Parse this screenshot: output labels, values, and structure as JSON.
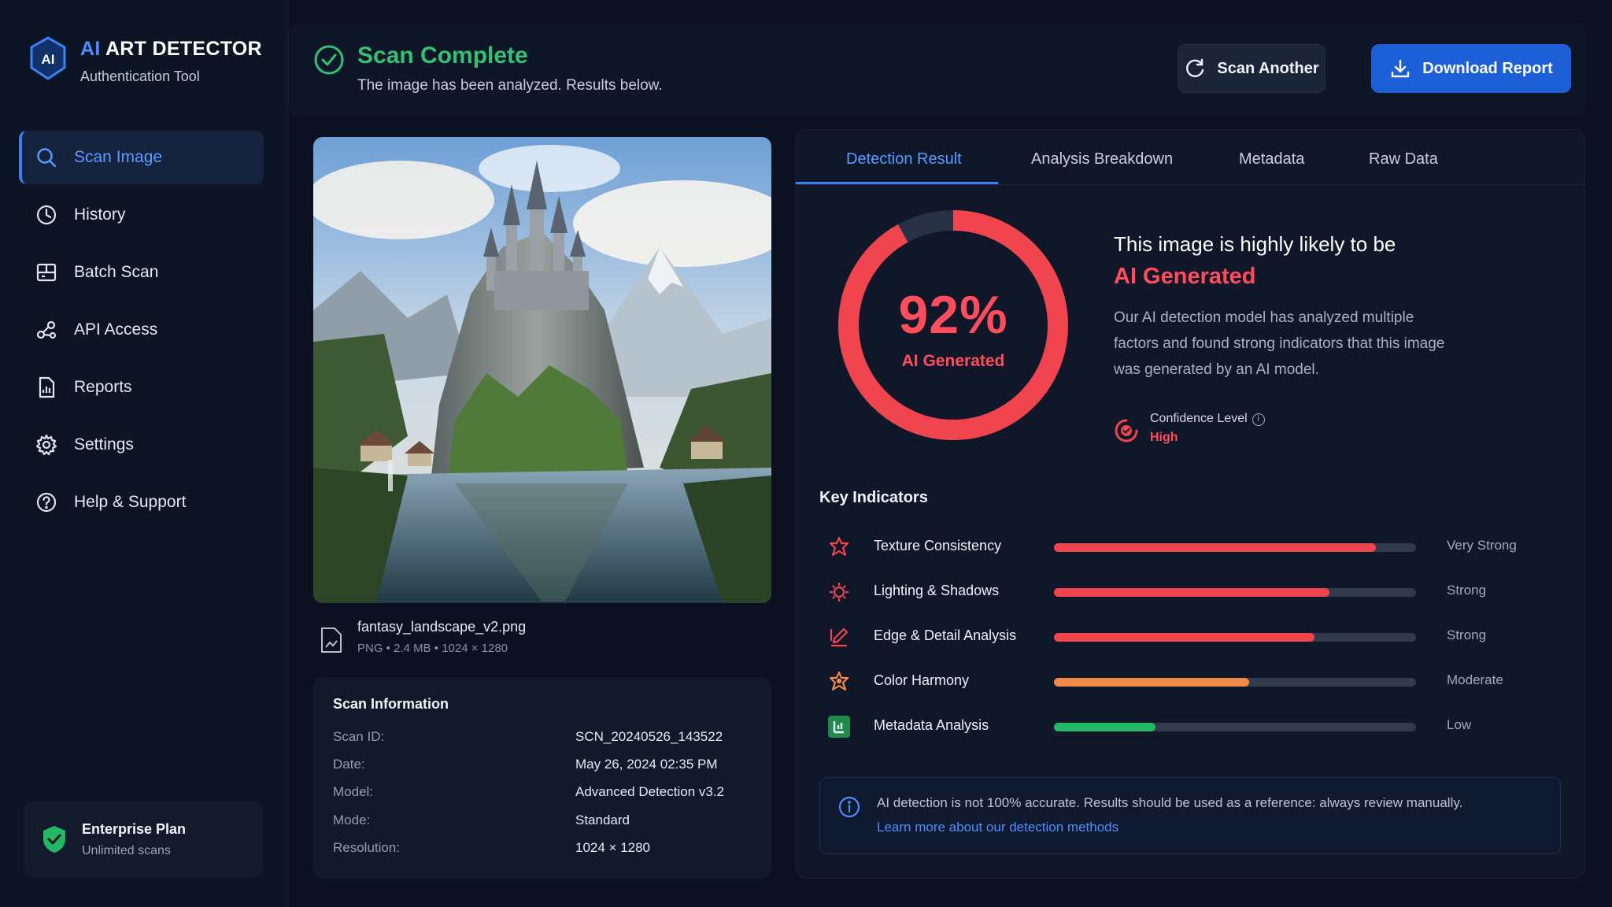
{
  "brand": {
    "title_ai": "AI",
    "title_rest": "ART DETECTOR",
    "subtitle": "Authentication Tool",
    "logo_text": "AI"
  },
  "sidebar": {
    "items": [
      {
        "label": "Scan Image",
        "icon": "search-icon",
        "active": true
      },
      {
        "label": "History",
        "icon": "clock-icon"
      },
      {
        "label": "Batch Scan",
        "icon": "batch-icon"
      },
      {
        "label": "API Access",
        "icon": "api-icon"
      },
      {
        "label": "Reports",
        "icon": "report-icon"
      },
      {
        "label": "Settings",
        "icon": "gear-icon"
      },
      {
        "label": "Help & Support",
        "icon": "help-icon"
      }
    ],
    "plan": {
      "title": "Enterprise Plan",
      "subtitle": "Unlimited scans"
    }
  },
  "header": {
    "title": "Scan Complete",
    "subtitle": "The image has been analyzed. Results below.",
    "scan_another": "Scan Another",
    "download_report": "Download Report"
  },
  "file": {
    "name": "fantasy_landscape_v2.png",
    "meta": "PNG • 2.4 MB • 1024 × 1280"
  },
  "scan_info": {
    "title": "Scan Information",
    "rows": [
      {
        "k": "Scan ID:",
        "v": "SCN_20240526_143522"
      },
      {
        "k": "Date:",
        "v": "May 26, 2024 02:35 PM"
      },
      {
        "k": "Model:",
        "v": "Advanced Detection v3.2"
      },
      {
        "k": "Mode:",
        "v": "Standard"
      },
      {
        "k": "Resolution:",
        "v": "1024 × 1280"
      }
    ]
  },
  "tabs": [
    "Detection Result",
    "Analysis Breakdown",
    "Metadata",
    "Raw Data"
  ],
  "result": {
    "percent_text": "92%",
    "percent": 0.92,
    "label": "AI Generated",
    "verdict_line1": "This image is highly likely to be",
    "verdict_line2": "AI Generated",
    "description": "Our AI detection model has analyzed multiple factors and found strong indicators that this image was generated by an AI model.",
    "confidence_label": "Confidence Level",
    "confidence_value": "High"
  },
  "indicators_title": "Key Indicators",
  "indicators": [
    {
      "name": "Texture Consistency",
      "value": 0.89,
      "level": "Very Strong",
      "color": "#f0454f"
    },
    {
      "name": "Lighting & Shadows",
      "value": 0.76,
      "level": "Strong",
      "color": "#f0454f"
    },
    {
      "name": "Edge & Detail Analysis",
      "value": 0.72,
      "level": "Strong",
      "color": "#f0454f"
    },
    {
      "name": "Color Harmony",
      "value": 0.54,
      "level": "Moderate",
      "color": "#f08a4b"
    },
    {
      "name": "Metadata Analysis",
      "value": 0.28,
      "level": "Low",
      "color": "#22b864"
    }
  ],
  "notice": {
    "text": "AI detection is not 100% accurate. Results should be used as a reference: always review manually.",
    "link": "Learn more about our detection methods"
  },
  "colors": {
    "accent": "#3b82f6",
    "danger": "#ff4d5e",
    "success": "#34c174"
  }
}
